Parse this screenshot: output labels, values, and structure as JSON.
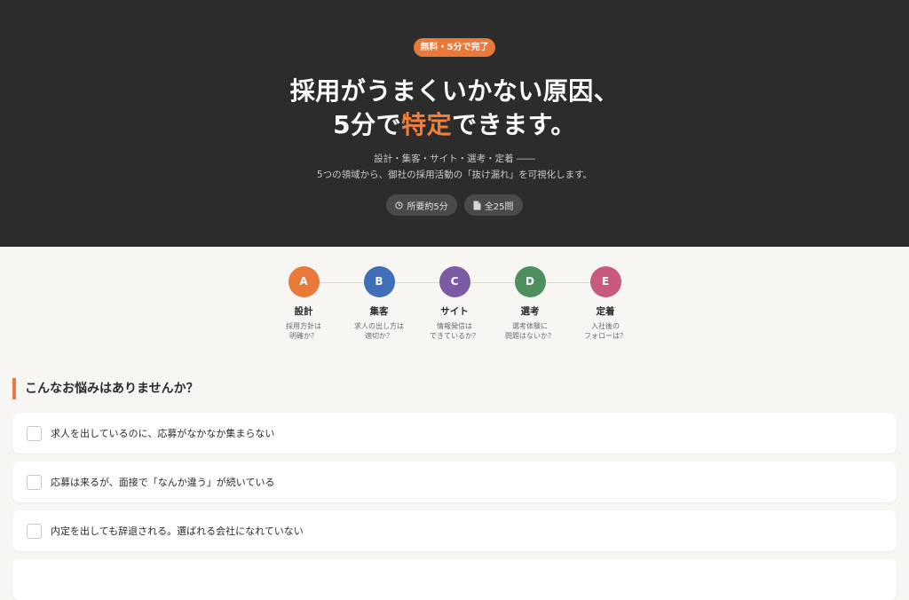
{
  "hero": {
    "badge": "無料・5分で完了",
    "headline_line1": "採用がうまくいかない原因、",
    "headline_pre": "5分で",
    "headline_accent": "特定",
    "headline_post": "できます。",
    "sub_line1": "設計・集客・サイト・選考・定着 ――",
    "sub_line2": "5つの領域から、御社の採用活動の「抜け漏れ」を可視化します。",
    "chips": [
      {
        "icon": "clock-icon",
        "label": "所要約5分"
      },
      {
        "icon": "document-icon",
        "label": "全25問"
      }
    ]
  },
  "steps": [
    {
      "letter": "A",
      "name": "設計",
      "desc": "採用方針は\n明確か？",
      "color": "#e8793a"
    },
    {
      "letter": "B",
      "name": "集客",
      "desc": "求人の出し方は\n適切か？",
      "color": "#3f6fb8"
    },
    {
      "letter": "C",
      "name": "サイト",
      "desc": "情報発信は\nできているか？",
      "color": "#7b5aa6"
    },
    {
      "letter": "D",
      "name": "選考",
      "desc": "選考体験に\n問題はないか？",
      "color": "#4f8f5e"
    },
    {
      "letter": "E",
      "name": "定着",
      "desc": "入社後の\nフォローは？",
      "color": "#c85a7e"
    }
  ],
  "section": {
    "title": "こんなお悩みはありませんか？"
  },
  "checklist": [
    {
      "label": "求人を出しているのに、応募がなかなか集まらない"
    },
    {
      "label": "応募は来るが、面接で「なんか違う」が続いている"
    },
    {
      "label": "内定を出しても辞退される。選ばれる会社になれていない"
    }
  ]
}
